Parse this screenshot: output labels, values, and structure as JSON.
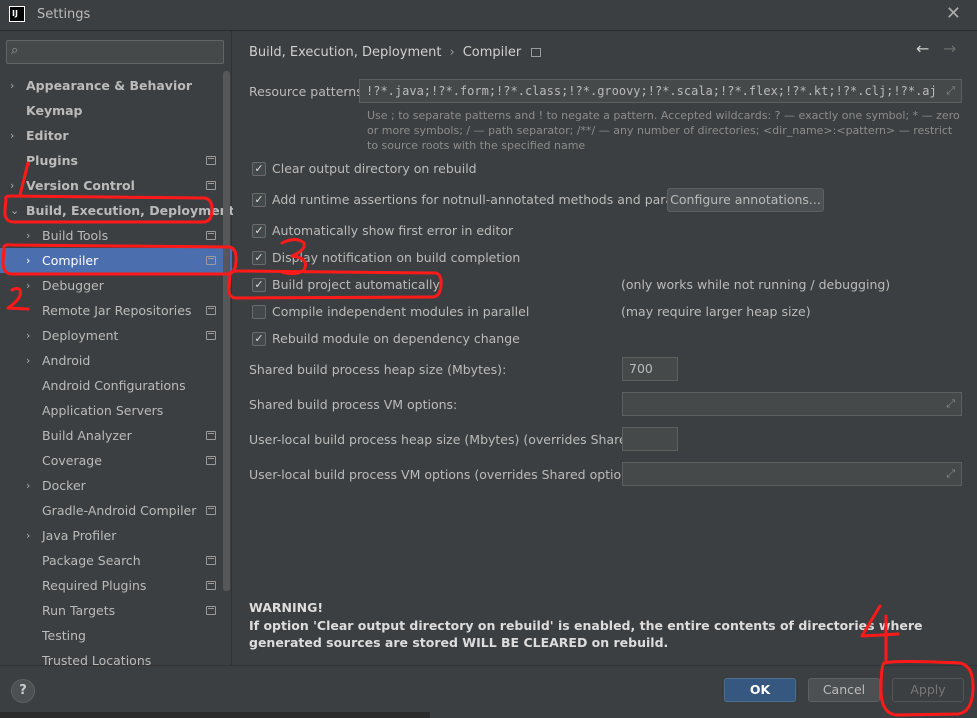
{
  "window": {
    "title": "Settings",
    "logo_text": "IJ",
    "close_glyph": "✕"
  },
  "search": {
    "placeholder": "",
    "icon": "search-icon",
    "value": ""
  },
  "sidebar": {
    "items": [
      {
        "label": "Appearance & Behavior",
        "level": 0,
        "chevron": "›",
        "bold": true,
        "icon": false
      },
      {
        "label": "Keymap",
        "level": 0,
        "chevron": "",
        "bold": true,
        "icon": false
      },
      {
        "label": "Editor",
        "level": 0,
        "chevron": "›",
        "bold": true,
        "icon": false
      },
      {
        "label": "Plugins",
        "level": 0,
        "chevron": "",
        "bold": true,
        "icon": true
      },
      {
        "label": "Version Control",
        "level": 0,
        "chevron": "›",
        "bold": true,
        "icon": true
      },
      {
        "label": "Build, Execution, Deployment",
        "level": 0,
        "chevron": "⌄",
        "bold": true,
        "icon": false
      },
      {
        "label": "Build Tools",
        "level": 1,
        "chevron": "›",
        "bold": false,
        "icon": true
      },
      {
        "label": "Compiler",
        "level": 1,
        "chevron": "›",
        "bold": false,
        "icon": true,
        "selected": true
      },
      {
        "label": "Debugger",
        "level": 1,
        "chevron": "›",
        "bold": false,
        "icon": false
      },
      {
        "label": "Remote Jar Repositories",
        "level": 1,
        "chevron": "",
        "bold": false,
        "icon": true
      },
      {
        "label": "Deployment",
        "level": 1,
        "chevron": "›",
        "bold": false,
        "icon": true
      },
      {
        "label": "Android",
        "level": 1,
        "chevron": "›",
        "bold": false,
        "icon": false
      },
      {
        "label": "Android Configurations",
        "level": 1,
        "chevron": "",
        "bold": false,
        "icon": false
      },
      {
        "label": "Application Servers",
        "level": 1,
        "chevron": "",
        "bold": false,
        "icon": false
      },
      {
        "label": "Build Analyzer",
        "level": 1,
        "chevron": "",
        "bold": false,
        "icon": true
      },
      {
        "label": "Coverage",
        "level": 1,
        "chevron": "",
        "bold": false,
        "icon": true
      },
      {
        "label": "Docker",
        "level": 1,
        "chevron": "›",
        "bold": false,
        "icon": false
      },
      {
        "label": "Gradle-Android Compiler",
        "level": 1,
        "chevron": "",
        "bold": false,
        "icon": true
      },
      {
        "label": "Java Profiler",
        "level": 1,
        "chevron": "›",
        "bold": false,
        "icon": false
      },
      {
        "label": "Package Search",
        "level": 1,
        "chevron": "",
        "bold": false,
        "icon": true
      },
      {
        "label": "Required Plugins",
        "level": 1,
        "chevron": "",
        "bold": false,
        "icon": true
      },
      {
        "label": "Run Targets",
        "level": 1,
        "chevron": "",
        "bold": false,
        "icon": true
      },
      {
        "label": "Testing",
        "level": 1,
        "chevron": "",
        "bold": false,
        "icon": false
      },
      {
        "label": "Trusted Locations",
        "level": 1,
        "chevron": "",
        "bold": false,
        "icon": false
      }
    ]
  },
  "breadcrumb": {
    "parent": "Build, Execution, Deployment",
    "separator": "›",
    "current": "Compiler"
  },
  "nav": {
    "back": "←",
    "forward": "→"
  },
  "resource_patterns": {
    "label": "Resource patterns:",
    "value": "!?*.java;!?*.form;!?*.class;!?*.groovy;!?*.scala;!?*.flex;!?*.kt;!?*.clj;!?*.aj",
    "hint": "Use ; to separate patterns and ! to negate a pattern. Accepted wildcards: ? — exactly one symbol; * — zero or more symbols; / — path separator; /**/ — any number of directories; <dir_name>:<pattern> — restrict to source roots with the specified name"
  },
  "options": [
    {
      "label": "Clear output directory on rebuild",
      "checked": true,
      "note": ""
    },
    {
      "label": "Add runtime assertions for notnull-annotated methods and parameters",
      "checked": true,
      "note": ""
    },
    {
      "label": "Automatically show first error in editor",
      "checked": true,
      "note": ""
    },
    {
      "label": "Display notification on build completion",
      "checked": true,
      "note": ""
    },
    {
      "label": "Build project automatically",
      "checked": true,
      "note": "(only works while not running / debugging)"
    },
    {
      "label": "Compile independent modules in parallel",
      "checked": false,
      "note": "(may require larger heap size)"
    },
    {
      "label": "Rebuild module on dependency change",
      "checked": true,
      "note": ""
    }
  ],
  "configure_annotations_label": "Configure annotations...",
  "fields": {
    "shared_heap": {
      "label": "Shared build process heap size (Mbytes):",
      "value": "700"
    },
    "shared_vm": {
      "label": "Shared build process VM options:",
      "value": ""
    },
    "local_heap": {
      "label": "User-local build process heap size (Mbytes) (overrides Shared size):",
      "value": ""
    },
    "local_vm": {
      "label": "User-local build process VM options (overrides Shared options):",
      "value": ""
    }
  },
  "warning": {
    "title": "WARNING!",
    "text": "If option 'Clear output directory on rebuild' is enabled, the entire contents of directories where generated sources are stored WILL BE CLEARED on rebuild."
  },
  "footer": {
    "help": "?",
    "ok": "OK",
    "cancel": "Cancel",
    "apply": "Apply"
  },
  "annotations": {
    "color": "#ff1a1a",
    "labels": [
      "1",
      "2",
      "3",
      "4"
    ]
  }
}
